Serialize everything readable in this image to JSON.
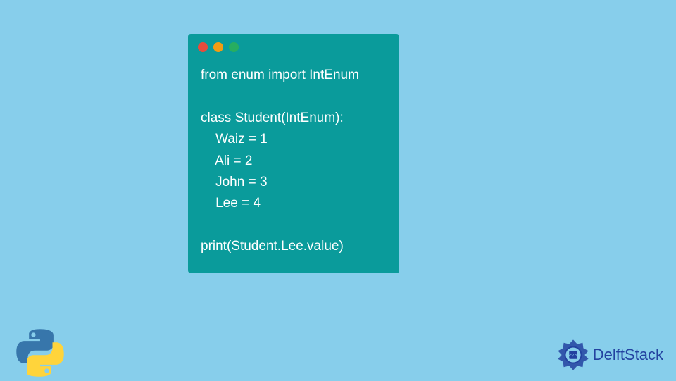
{
  "code": {
    "lines": [
      "from enum import IntEnum",
      "",
      "class Student(IntEnum):",
      "    Waiz = 1",
      "    Ali = 2",
      "    John = 3",
      "    Lee = 4",
      "",
      "print(Student.Lee.value)"
    ]
  },
  "brand": {
    "name": "DelftStack"
  }
}
